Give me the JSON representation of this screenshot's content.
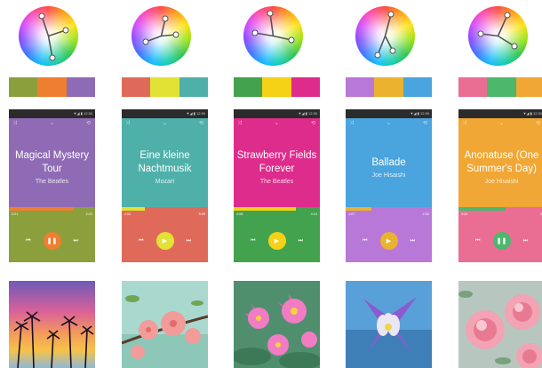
{
  "columns": [
    {
      "wheel_colors": [
        "#8ba03d",
        "#ef7f30",
        "#8f6bb5"
      ],
      "palette": [
        "#8ba03d",
        "#ef7f30",
        "#8f6bb5"
      ],
      "player": {
        "status_text": "▼◢ ▮ 12:30",
        "shuffle_icon": "shuffle-icon",
        "collapse_icon": "chevron-down-icon",
        "repeat_icon": "repeat-icon",
        "title": "Magical Mystery Tour",
        "artist": "The Beatles",
        "elapsed": "2:21",
        "duration": "2:21",
        "progress": 0.75,
        "bg_top": "#8f6bb5",
        "bg_bottom": "#8ba03d",
        "progress_color": "#ef7f30",
        "button_color": "#ef7f30",
        "state": "pause"
      },
      "photo": "palm-trees-sunset"
    },
    {
      "wheel_colors": [
        "#e06a5a",
        "#e2e234",
        "#4fb0aa"
      ],
      "palette": [
        "#e06a5a",
        "#e2e234",
        "#4fb0aa"
      ],
      "player": {
        "status_text": "▼◢ ▮ 12:30",
        "shuffle_icon": "shuffle-icon",
        "collapse_icon": "chevron-down-icon",
        "repeat_icon": "repeat-icon",
        "title": "Eine kleine Nachtmusik",
        "artist": "Mozart",
        "elapsed": "2:02",
        "duration": "5:09",
        "progress": 0.27,
        "bg_top": "#4fb0aa",
        "bg_bottom": "#e06a5a",
        "progress_color": "#e2e234",
        "button_color": "#e2e234",
        "state": "play"
      },
      "photo": "pink-blossom-branch"
    },
    {
      "wheel_colors": [
        "#43a24e",
        "#f5d215",
        "#de2c8c"
      ],
      "palette": [
        "#43a24e",
        "#f5d215",
        "#de2c8c"
      ],
      "player": {
        "status_text": "▼◢ ▮ 12:30",
        "shuffle_icon": "shuffle-icon",
        "collapse_icon": "chevron-down-icon",
        "repeat_icon": "repeat-icon",
        "title": "Strawberry Fields Forever",
        "artist": "The Beatles",
        "elapsed": "2:08",
        "duration": "4:10",
        "progress": 0.72,
        "bg_top": "#de2c8c",
        "bg_bottom": "#43a24e",
        "progress_color": "#f5d215",
        "button_color": "#f5d215",
        "state": "play"
      },
      "photo": "lotus-flowers"
    },
    {
      "wheel_colors": [
        "#b878d8",
        "#ebb230",
        "#4aa4dd"
      ],
      "palette": [
        "#b878d8",
        "#ebb230",
        "#4aa4dd"
      ],
      "player": {
        "status_text": "▼◢ ▮ 12:30",
        "shuffle_icon": "shuffle-icon",
        "collapse_icon": "chevron-down-icon",
        "repeat_icon": "repeat-icon",
        "title": "Ballade",
        "artist": "Joe Hisaishi",
        "elapsed": "1:07",
        "duration": "2:32",
        "progress": 0.3,
        "bg_top": "#4aa4dd",
        "bg_bottom": "#b878d8",
        "progress_color": "#ebb230",
        "button_color": "#ebb230",
        "state": "play"
      },
      "photo": "columbine-flower"
    },
    {
      "wheel_colors": [
        "#ea6e94",
        "#4bb86c",
        "#f0a735"
      ],
      "palette": [
        "#ea6e94",
        "#4bb86c",
        "#f0a735"
      ],
      "player": {
        "status_text": "▼◢ ▮ 12:30",
        "shuffle_icon": "shuffle-icon",
        "collapse_icon": "chevron-down-icon",
        "repeat_icon": "repeat-icon",
        "title": "Anonatuse (One Summer's Day)",
        "artist": "Joe Hisaishi",
        "elapsed": "3:24",
        "duration": "4",
        "progress": 0.55,
        "bg_top": "#f0a735",
        "bg_bottom": "#ea6e94",
        "progress_color": "#4bb86c",
        "button_color": "#4bb86c",
        "state": "pause"
      },
      "photo": "peony-flowers"
    }
  ]
}
